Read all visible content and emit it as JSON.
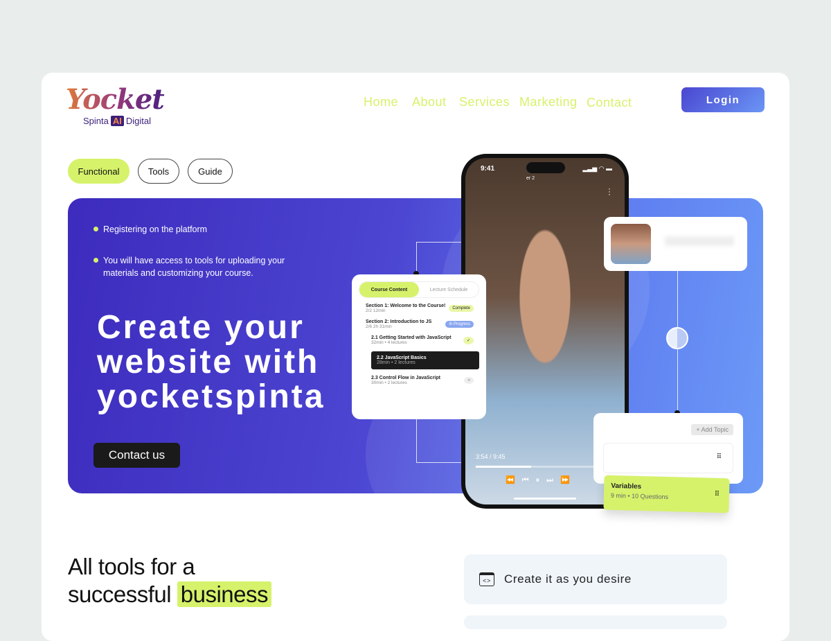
{
  "logo": {
    "main": "Yocket",
    "sub_left": "Spinta",
    "sub_ai": "AI",
    "sub_right": "Digital"
  },
  "nav": {
    "items": [
      "Home",
      "About",
      "Services",
      "Marketing",
      "Contact"
    ],
    "login": "Login"
  },
  "filters": [
    "Functional",
    "Tools",
    "Guide"
  ],
  "hero": {
    "bullets": [
      "Registering on the platform",
      "You will have access to tools for uploading your materials and customizing your course."
    ],
    "headline": [
      "Create your",
      "website with",
      "yocketspinta"
    ],
    "cta": "Contact us"
  },
  "phone": {
    "time": "9:41",
    "caption": "er 2",
    "progress": "3:54 / 9:45",
    "progress_fraction": 0.4
  },
  "course": {
    "tabs": [
      "Course Content",
      "Lecture Schedule"
    ],
    "sections": [
      {
        "title": "Section 1: Welcome to the Course!",
        "meta": "2/2   12min",
        "badge": "Complete"
      },
      {
        "title": "Section 2: Introduction to JS",
        "meta": "2/6   2h 31min",
        "badge": "In Progress"
      }
    ],
    "lessons": [
      {
        "title": "2.1 Getting Started with JavaScript",
        "meta": "32min  •  4 lectures"
      },
      {
        "title": "2.2 JavaScript Basics",
        "meta": "28min  •  2 lectures"
      },
      {
        "title": "2.3 Control Flow in JavaScript",
        "meta": "30min  •  2 lectures"
      }
    ]
  },
  "topic": {
    "add": "+ Add Topic",
    "variable_title": "Variables",
    "variable_meta": "9 min  •  10 Questions"
  },
  "section2": {
    "title_a": "All tools for a",
    "title_b": "successful",
    "title_hl": "business",
    "feature": "Create it as you desire"
  },
  "colors": {
    "accent": "#d6f26b",
    "primary": "#4a46d0",
    "dark": "#1a1a1a"
  }
}
